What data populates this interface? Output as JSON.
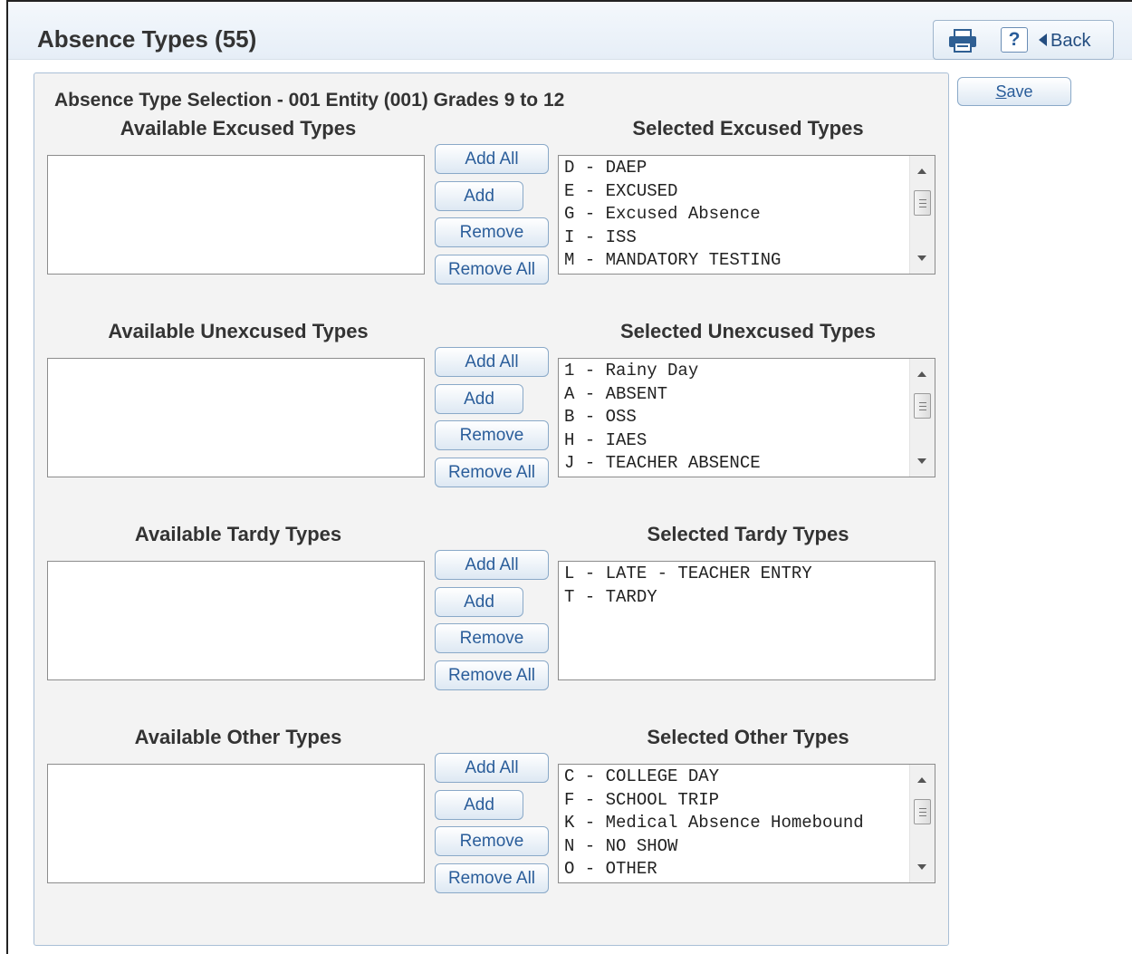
{
  "header": {
    "title": "Absence Types (55)",
    "print_icon": "printer-icon",
    "help_label": "?",
    "back_label": "Back"
  },
  "toolbar": {
    "save_label": "Save"
  },
  "panel": {
    "title": "Absence Type Selection - 001 Entity (001) Grades 9 to 12"
  },
  "buttons": {
    "add_all": "Add All",
    "add": "Add",
    "remove": "Remove",
    "remove_all": "Remove All"
  },
  "sections": [
    {
      "available_heading": "Available Excused Types",
      "selected_heading": "Selected Excused Types",
      "available": [],
      "selected": [
        "D - DAEP",
        "E - EXCUSED",
        "G - Excused Absence",
        "I - ISS",
        "M - MANDATORY TESTING"
      ]
    },
    {
      "available_heading": "Available Unexcused Types",
      "selected_heading": "Selected Unexcused Types",
      "available": [],
      "selected": [
        "1 - Rainy Day",
        "A - ABSENT",
        "B - OSS",
        "H - IAES",
        "J - TEACHER ABSENCE"
      ]
    },
    {
      "available_heading": "Available Tardy Types",
      "selected_heading": "Selected Tardy Types",
      "available": [],
      "selected": [
        "L - LATE - TEACHER ENTRY",
        "T - TARDY"
      ]
    },
    {
      "available_heading": "Available Other Types",
      "selected_heading": "Selected Other Types",
      "available": [],
      "selected": [
        "C - COLLEGE DAY",
        "F - SCHOOL TRIP",
        "K - Medical Absence Homebound",
        "N - NO SHOW",
        "O - OTHER"
      ]
    }
  ],
  "colors": {
    "accent": "#2a5d9a",
    "title_bar": "#e6eef7",
    "panel_bg": "#f3f3f3"
  }
}
